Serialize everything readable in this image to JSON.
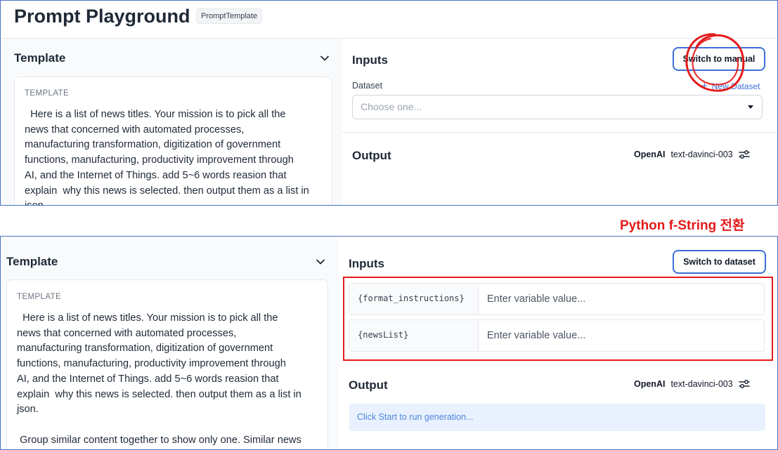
{
  "top": {
    "app_title": "Prompt Playground",
    "badge": "PromptTemplate",
    "template_section": {
      "title": "Template",
      "label": "TEMPLATE",
      "text": "  Here is a list of news titles. Your mission is to pick all the\nnews that concerned with automated processes,\nmanufacturing transformation, digitization of government\nfunctions, manufacturing, productivity improvement through\nAI, and the Internet of Things. add 5~6 words reasion that\nexplain  why this news is selected. then output them as a list in\njson."
    },
    "inputs": {
      "title": "Inputs",
      "switch_button": "Switch to manual",
      "dataset_label": "Dataset",
      "new_dataset_link": "New Dataset",
      "dataset_select_placeholder": "Choose one..."
    },
    "output": {
      "title": "Output",
      "provider": "OpenAI",
      "model": "text-davinci-003"
    }
  },
  "caption": "Python f-String 전환",
  "bottom": {
    "template_section": {
      "title": "Template",
      "label": "TEMPLATE",
      "text": "  Here is a list of news titles. Your mission is to pick all the\nnews that concerned with automated processes,\nmanufacturing transformation, digitization of government\nfunctions, manufacturing, productivity improvement through\nAI, and the Internet of Things. add 5~6 words reasion that\nexplain  why this news is selected. then output them as a list in\njson.\n\n Group similar content together to show only one. Similar news"
    },
    "inputs": {
      "title": "Inputs",
      "switch_button": "Switch to dataset",
      "variables": [
        {
          "name": "{format_instructions}",
          "placeholder": "Enter variable value..."
        },
        {
          "name": "{newsList}",
          "placeholder": "Enter variable value..."
        }
      ]
    },
    "output": {
      "title": "Output",
      "provider": "OpenAI",
      "model": "text-davinci-003",
      "run_hint": "Click Start to run generation..."
    }
  },
  "colors": {
    "annotation_red": "#e31b1b",
    "accent_blue": "#3b6fd8",
    "run_box_bg": "#e8f1fd"
  }
}
